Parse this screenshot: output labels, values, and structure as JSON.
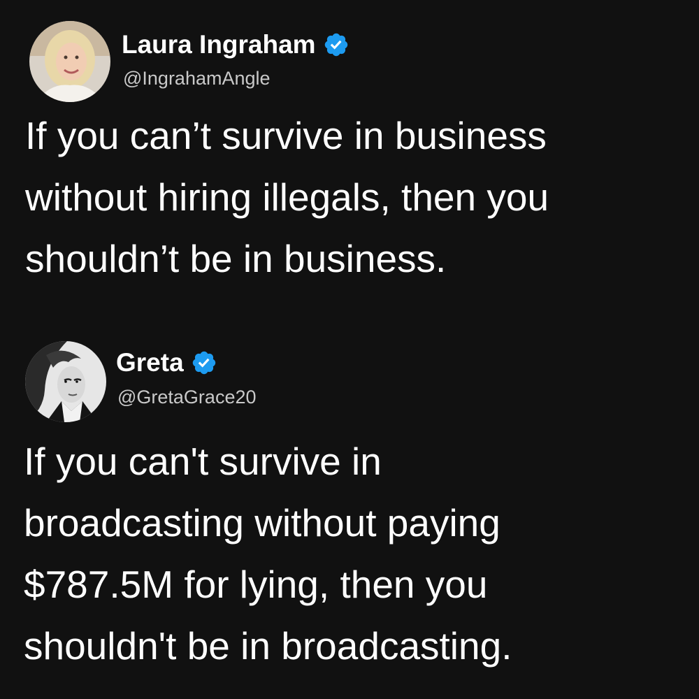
{
  "tweets": [
    {
      "author": {
        "name": "Laura Ingraham",
        "handle": "@IngrahamAngle",
        "verified": true
      },
      "lines": [
        "If you can’t survive in business",
        "without hiring illegals, then you",
        "shouldn’t be in business."
      ]
    },
    {
      "author": {
        "name": "Greta",
        "handle": "@GretaGrace20",
        "verified": true
      },
      "lines": [
        "If you can't survive in",
        "broadcasting without paying",
        "$787.5M for lying, then you",
        "shouldn't be in broadcasting."
      ]
    }
  ],
  "colors": {
    "background": "#111111",
    "text": "#ffffff",
    "handle": "#c9c9c9",
    "verified_badge": "#1d9bf0"
  },
  "icons": {
    "verified": "verified-badge-icon"
  }
}
